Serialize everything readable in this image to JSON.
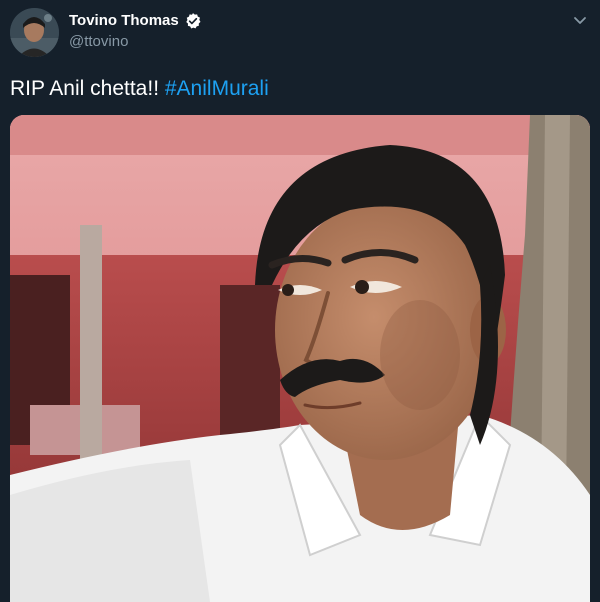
{
  "tweet": {
    "display_name": "Tovino Thomas",
    "handle": "@ttovino",
    "text_plain": "RIP Anil chetta!! ",
    "hashtag": "#AnilMurali"
  },
  "colors": {
    "background": "#15202b",
    "text": "#ffffff",
    "muted": "#8899a6",
    "link": "#1da1f2",
    "verified": "#ffffff"
  },
  "icons": {
    "verified": "verified-badge-icon",
    "caret": "chevron-down-icon"
  }
}
